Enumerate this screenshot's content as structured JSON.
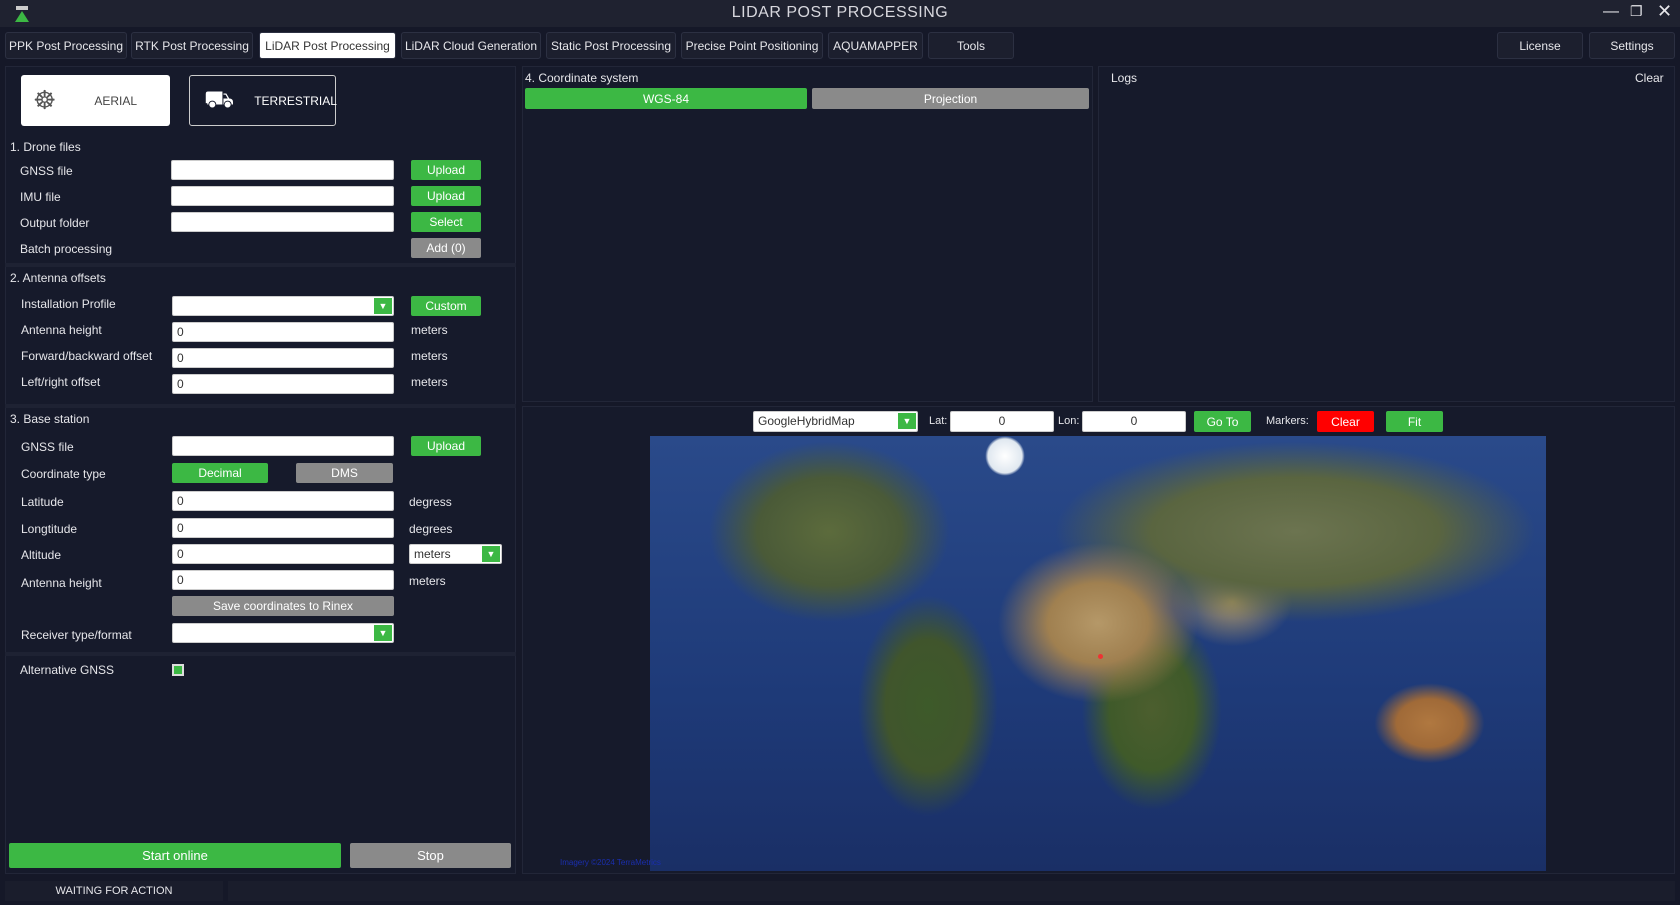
{
  "window": {
    "title": "LIDAR POST PROCESSING"
  },
  "tabs": [
    {
      "label": "PPK Post Processing"
    },
    {
      "label": "RTK Post Processing"
    },
    {
      "label": "LiDAR Post Processing",
      "active": true
    },
    {
      "label": "LiDAR Cloud Generation"
    },
    {
      "label": "Static Post Processing"
    },
    {
      "label": "Precise Point Positioning"
    },
    {
      "label": "AQUAMAPPER"
    },
    {
      "label": "Tools"
    }
  ],
  "right_tabs": {
    "license": "License",
    "settings": "Settings"
  },
  "mode": {
    "aerial": "AERIAL",
    "terrestrial": "TERRESTRIAL"
  },
  "drone": {
    "heading": "1. Drone files",
    "gnss": "GNSS file",
    "imu": "IMU file",
    "output": "Output folder",
    "batch": "Batch processing",
    "upload": "Upload",
    "select": "Select",
    "add": "Add (0)",
    "gnss_value": "",
    "imu_value": "",
    "output_value": ""
  },
  "antenna": {
    "heading": "2. Antenna offsets",
    "profile": "Installation Profile",
    "custom": "Custom",
    "height": "Antenna height",
    "fwd": "Forward/backward offset",
    "lr": "Left/right offset",
    "height_value": "0",
    "fwd_value": "0",
    "lr_value": "0",
    "unit": "meters",
    "profile_value": ""
  },
  "base": {
    "heading": "3. Base station",
    "gnss": "GNSS file",
    "upload": "Upload",
    "coord_type": "Coordinate type",
    "decimal": "Decimal",
    "dms": "DMS",
    "lat": "Latitude",
    "lon": "Longtitude",
    "alt": "Altitude",
    "ant": "Antenna height",
    "lat_value": "0",
    "lon_value": "0",
    "alt_value": "0",
    "ant_value": "0",
    "lat_unit": "degress",
    "lon_unit": "degrees",
    "alt_unit": "meters",
    "ant_unit": "meters",
    "save": "Save coordinates to Rinex",
    "receiver": "Receiver type/format",
    "receiver_value": ""
  },
  "alt_gnss": {
    "label": "Alternative GNSS",
    "checked": true
  },
  "actions": {
    "start": "Start online",
    "stop": "Stop"
  },
  "status": {
    "text": "WAITING FOR ACTION"
  },
  "coord": {
    "heading": "4. Coordinate system",
    "wgs": "WGS-84",
    "projection": "Projection"
  },
  "logs": {
    "heading": "Logs",
    "clear": "Clear"
  },
  "map": {
    "provider": "GoogleHybridMap",
    "lat_label": "Lat:",
    "lat": "0",
    "lon_label": "Lon:",
    "lon": "0",
    "goto": "Go To",
    "markers": "Markers:",
    "clear": "Clear",
    "fit": "Fit",
    "attribution": "Imagery ©2024 TerraMetrics"
  },
  "colors": {
    "accent": "#3cb844",
    "danger": "#ff0000",
    "background": "#151828"
  }
}
